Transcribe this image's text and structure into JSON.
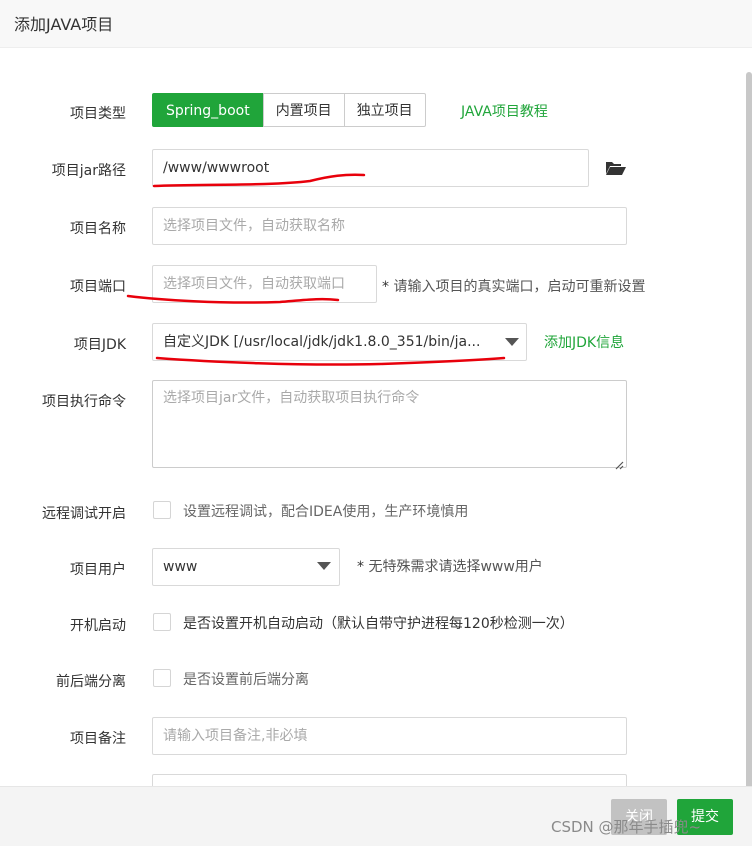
{
  "dialog": {
    "title": "添加JAVA项目"
  },
  "form": {
    "type": {
      "label": "项目类型",
      "options": [
        "Spring_boot",
        "内置项目",
        "独立项目"
      ],
      "selected": "Spring_boot",
      "tutorial_link": "JAVA项目教程"
    },
    "jar_path": {
      "label": "项目jar路径",
      "value": "/www/wwwroot",
      "folder_icon": "folder-open-icon"
    },
    "name": {
      "label": "项目名称",
      "placeholder": "选择项目文件，自动获取名称"
    },
    "port": {
      "label": "项目端口",
      "placeholder": "选择项目文件，自动获取端口",
      "hint_star": "*",
      "hint": "请输入项目的真实端口，启动可重新设置"
    },
    "jdk": {
      "label": "项目JDK",
      "value": "自定义JDK [/usr/local/jdk/jdk1.8.0_351/bin/ja...",
      "add_link": "添加JDK信息"
    },
    "command": {
      "label": "项目执行命令",
      "placeholder": "选择项目jar文件，自动获取项目执行命令"
    },
    "remote_debug": {
      "label": "远程调试开启",
      "text": "设置远程调试，配合IDEA使用，生产环境慎用",
      "checked": false
    },
    "user": {
      "label": "项目用户",
      "value": "www",
      "hint_star": "*",
      "hint": "无特殊需求请选择www用户"
    },
    "autostart": {
      "label": "开机启动",
      "text": "是否设置开机自动启动（默认自带守护进程每120秒检测一次）",
      "checked": false
    },
    "separation": {
      "label": "前后端分离",
      "text": "是否设置前后端分离",
      "checked": false
    },
    "remark": {
      "label": "项目备注",
      "placeholder": "请输入项目备注,非必填"
    }
  },
  "footer": {
    "close_label": "关闭",
    "submit_label": "提交"
  },
  "watermark": "CSDN @那年手插兜~",
  "colors": {
    "accent": "#20a53a",
    "annotation": "#e8000b",
    "close_btn": "#c2c2c2"
  }
}
